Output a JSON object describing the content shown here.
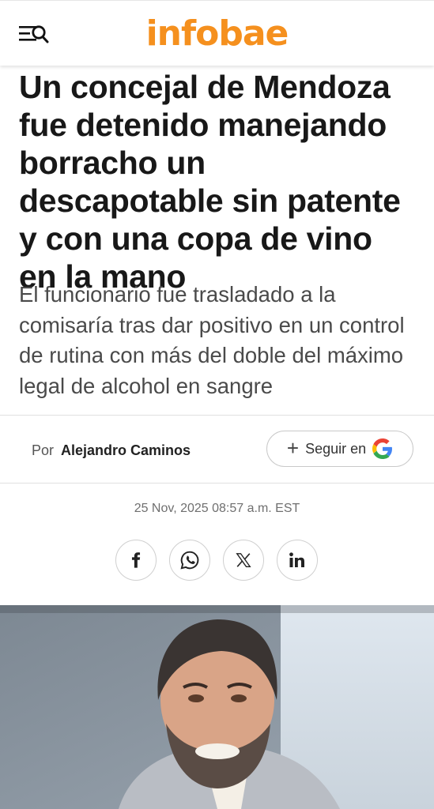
{
  "header": {
    "logo_text": "infobae",
    "menu_icon": "menu-search-icon",
    "brand_color": "#f5901e"
  },
  "article": {
    "title": "Un concejal de Mendoza fue detenido manejando borracho un descapotable sin patente y con una copa de vino en la mano",
    "subtitle": "El funcionario fue trasladado a la comisaría tras dar positivo en un control de rutina con más del doble del máximo legal de alcohol en sangre",
    "author_prefix": "Por",
    "author_name": "Alejandro Caminos",
    "follow_label": "Seguir en",
    "date": "25 Nov, 2025 08:57 a.m. EST"
  },
  "share": [
    {
      "icon": "facebook-icon"
    },
    {
      "icon": "whatsapp-icon"
    },
    {
      "icon": "x-icon"
    },
    {
      "icon": "linkedin-icon"
    }
  ]
}
